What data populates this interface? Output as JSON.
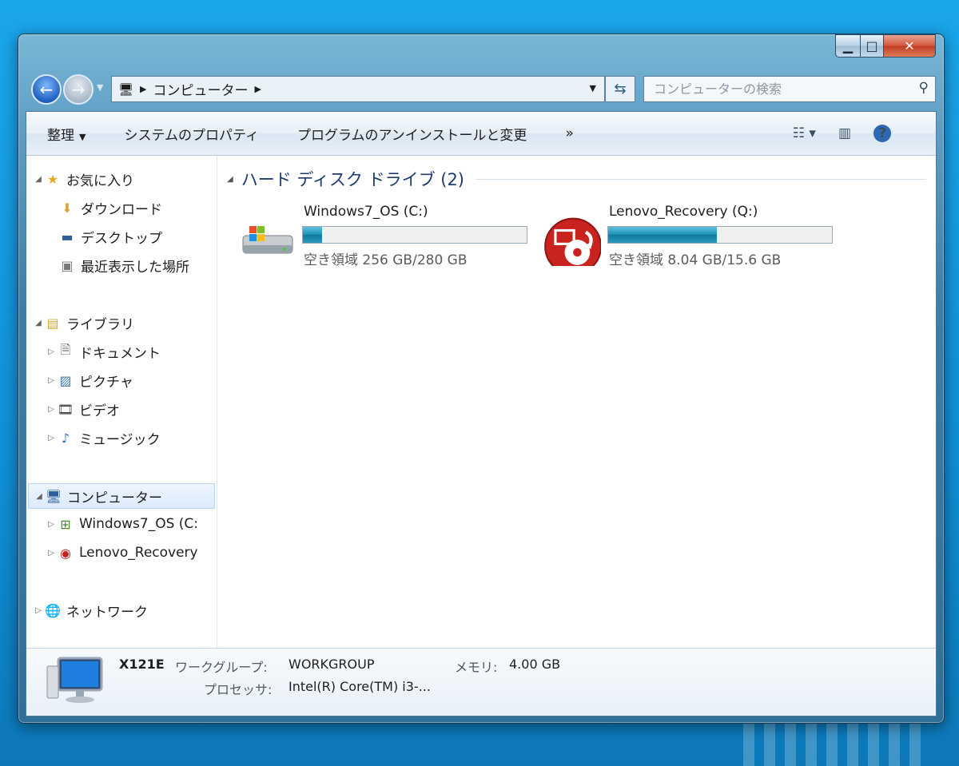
{
  "window": {
    "caption_buttons": {
      "minimize": "▁",
      "maximize": "□",
      "close": "✕"
    }
  },
  "address": {
    "path": "コンピューター",
    "search_placeholder": "コンピューターの検索"
  },
  "toolbar": {
    "organize": "整理",
    "system_properties": "システムのプロパティ",
    "uninstall": "プログラムのアンインストールと変更",
    "more": "»"
  },
  "nav": {
    "favorites": {
      "label": "お気に入り",
      "items": [
        "ダウンロード",
        "デスクトップ",
        "最近表示した場所"
      ]
    },
    "libraries": {
      "label": "ライブラリ",
      "items": [
        "ドキュメント",
        "ピクチャ",
        "ビデオ",
        "ミュージック"
      ]
    },
    "computer": {
      "label": "コンピューター",
      "items": [
        "Windows7_OS (C:",
        "Lenovo_Recovery"
      ]
    },
    "network": {
      "label": "ネットワーク"
    }
  },
  "content": {
    "group_title": "ハード ディスク ドライブ (2)",
    "drives": [
      {
        "name": "Windows7_OS (C:)",
        "free_text": "空き領域 256 GB/280 GB",
        "used_fraction": 0.086,
        "icon": "hdd-windows-icon"
      },
      {
        "name": "Lenovo_Recovery (Q:)",
        "free_text": "空き領域 8.04 GB/15.6 GB",
        "used_fraction": 0.485,
        "icon": "recovery-drive-icon"
      }
    ]
  },
  "details": {
    "computer_name": "X121E",
    "workgroup_label": "ワークグループ:",
    "workgroup": "WORKGROUP",
    "memory_label": "メモリ:",
    "memory": "4.00 GB",
    "processor_label": "プロセッサ:",
    "processor": "Intel(R) Core(TM) i3-..."
  },
  "colors": {
    "accent": "#1f5fbf",
    "bar_fill": "#1a8fb3",
    "desktop": "#1aa6ea"
  }
}
